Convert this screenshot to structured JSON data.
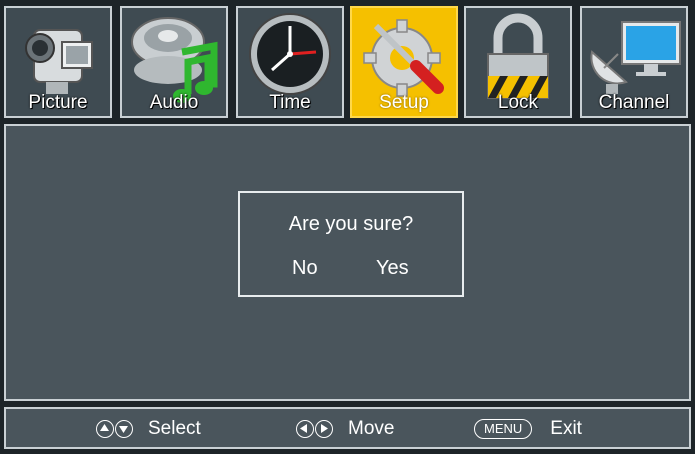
{
  "tabs": [
    {
      "label": "Picture",
      "icon": "camcorder-icon",
      "active": false
    },
    {
      "label": "Audio",
      "icon": "speaker-music-icon",
      "active": false
    },
    {
      "label": "Time",
      "icon": "clock-icon",
      "active": false
    },
    {
      "label": "Setup",
      "icon": "gear-screwdriver-icon",
      "active": true
    },
    {
      "label": "Lock",
      "icon": "padlock-icon",
      "active": false
    },
    {
      "label": "Channel",
      "icon": "satellite-monitor-icon",
      "active": false
    }
  ],
  "dialog": {
    "question": "Are you sure?",
    "no_label": "No",
    "yes_label": "Yes"
  },
  "bottom_bar": {
    "select_label": "Select",
    "move_label": "Move",
    "menu_key": "MENU",
    "exit_label": "Exit"
  },
  "colors": {
    "panel": "#4a555c",
    "active_tab": "#f5c000",
    "border": "#c9d0d4"
  }
}
